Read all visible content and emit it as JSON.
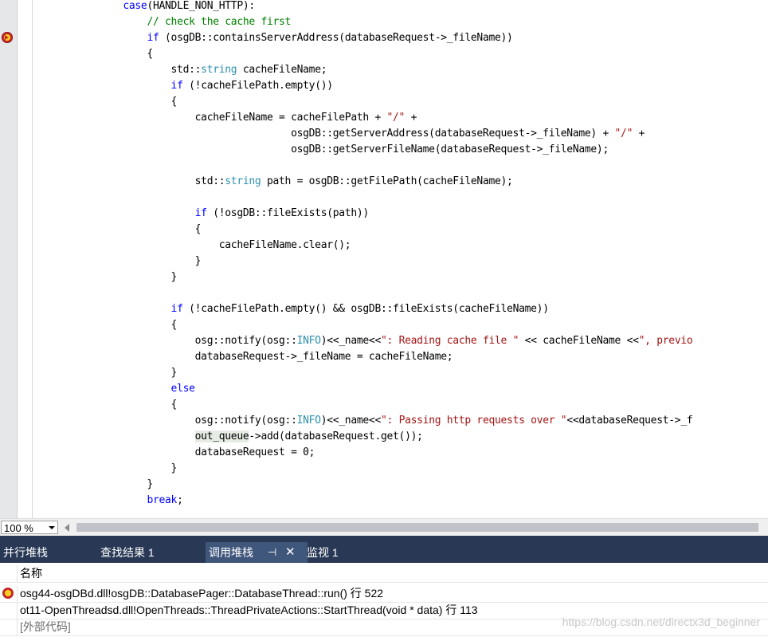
{
  "editor": {
    "lines": [
      [
        {
          "t": "            "
        },
        {
          "t": "case",
          "c": "kw"
        },
        {
          "t": "(HANDLE_NON_HTTP):"
        }
      ],
      [
        {
          "t": "                "
        },
        {
          "t": "// check the cache first",
          "c": "cm"
        }
      ],
      [
        {
          "t": "                "
        },
        {
          "t": "if",
          "c": "kw"
        },
        {
          "t": " (osgDB::containsServerAddress(databaseRequest->_fileName))"
        }
      ],
      [
        {
          "t": "                {"
        }
      ],
      [
        {
          "t": "                    std::"
        },
        {
          "t": "string",
          "c": "ty"
        },
        {
          "t": " cacheFileName;"
        }
      ],
      [
        {
          "t": "                    "
        },
        {
          "t": "if",
          "c": "kw"
        },
        {
          "t": " (!cacheFilePath.empty())"
        }
      ],
      [
        {
          "t": "                    {"
        }
      ],
      [
        {
          "t": "                        cacheFileName = cacheFilePath + "
        },
        {
          "t": "\"/\"",
          "c": "st"
        },
        {
          "t": " +"
        }
      ],
      [
        {
          "t": "                                        osgDB::getServerAddress(databaseRequest->_fileName) + "
        },
        {
          "t": "\"/\"",
          "c": "st"
        },
        {
          "t": " +"
        }
      ],
      [
        {
          "t": "                                        osgDB::getServerFileName(databaseRequest->_fileName);"
        }
      ],
      [
        {
          "t": ""
        }
      ],
      [
        {
          "t": "                        std::"
        },
        {
          "t": "string",
          "c": "ty"
        },
        {
          "t": " path = osgDB::getFilePath(cacheFileName);"
        }
      ],
      [
        {
          "t": ""
        }
      ],
      [
        {
          "t": "                        "
        },
        {
          "t": "if",
          "c": "kw"
        },
        {
          "t": " (!osgDB::fileExists(path))"
        }
      ],
      [
        {
          "t": "                        {"
        }
      ],
      [
        {
          "t": "                            cacheFileName.clear();"
        }
      ],
      [
        {
          "t": "                        }"
        }
      ],
      [
        {
          "t": "                    }"
        }
      ],
      [
        {
          "t": ""
        }
      ],
      [
        {
          "t": "                    "
        },
        {
          "t": "if",
          "c": "kw"
        },
        {
          "t": " (!cacheFilePath.empty() && osgDB::fileExists(cacheFileName))"
        }
      ],
      [
        {
          "t": "                    {"
        }
      ],
      [
        {
          "t": "                        osg::notify(osg::"
        },
        {
          "t": "INFO",
          "c": "ty"
        },
        {
          "t": ")<<_name<<"
        },
        {
          "t": "\": Reading cache file \"",
          "c": "st"
        },
        {
          "t": " << cacheFileName <<"
        },
        {
          "t": "\", previo",
          "c": "st"
        }
      ],
      [
        {
          "t": "                        databaseRequest->_fileName = cacheFileName;"
        }
      ],
      [
        {
          "t": "                    }"
        }
      ],
      [
        {
          "t": "                    "
        },
        {
          "t": "else",
          "c": "kw"
        }
      ],
      [
        {
          "t": "                    {"
        }
      ],
      [
        {
          "t": "                        osg::notify(osg::"
        },
        {
          "t": "INFO",
          "c": "ty"
        },
        {
          "t": ")<<_name<<"
        },
        {
          "t": "\": Passing http requests over \"",
          "c": "st"
        },
        {
          "t": "<<databaseRequest->_f"
        }
      ],
      [
        {
          "t": "                        "
        },
        {
          "t": "out_queue",
          "c": "hl"
        },
        {
          "t": "->add(databaseRequest.get());"
        }
      ],
      [
        {
          "t": "                        databaseRequest = 0;"
        }
      ],
      [
        {
          "t": "                    }"
        }
      ],
      [
        {
          "t": "                }"
        }
      ],
      [
        {
          "t": "                "
        },
        {
          "t": "break",
          "c": "kw"
        },
        {
          "t": ";"
        }
      ]
    ]
  },
  "zoom": {
    "value": "100 %"
  },
  "tabs": [
    {
      "label": "并行堆栈",
      "active": false
    },
    {
      "label": "查找结果 1",
      "active": false
    },
    {
      "label": "调用堆栈",
      "active": true
    },
    {
      "label": "监视 1",
      "active": false
    }
  ],
  "tab_icons": {
    "pin": "pin-icon",
    "close": "close-icon"
  },
  "callstack": {
    "header": "名称",
    "rows": [
      {
        "text": "osg44-osgDBd.dll!osgDB::DatabasePager::DatabaseThread::run() 行 522",
        "current": true
      },
      {
        "text": "ot11-OpenThreadsd.dll!OpenThreads::ThreadPrivateActions::StartThread(void * data) 行 113",
        "current": false
      },
      {
        "text": "[外部代码]",
        "current": false,
        "external": true
      }
    ]
  },
  "watermark": "https://blog.csdn.net/directx3d_beginner",
  "colors": {
    "keyword": "#0000ff",
    "comment": "#008000",
    "string": "#a31515",
    "type": "#2b91af",
    "tabbar": "#293955"
  }
}
